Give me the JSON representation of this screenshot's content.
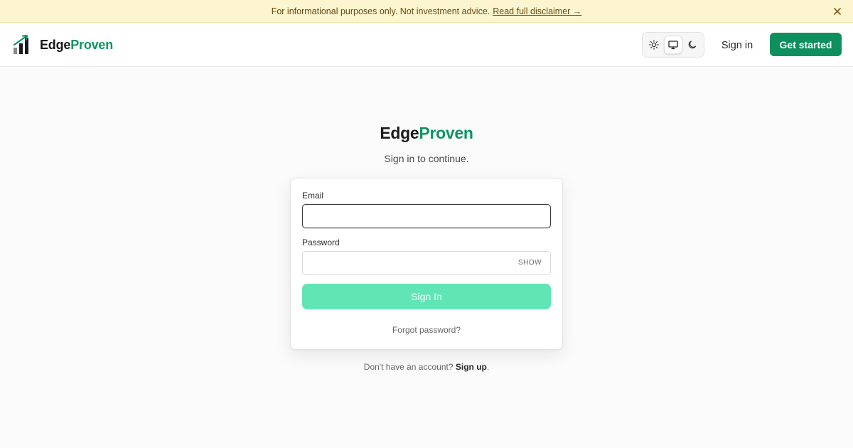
{
  "banner": {
    "text": "For informational purposes only. Not investment advice.",
    "link": "Read full disclaimer →",
    "close_icon": "close-icon"
  },
  "header": {
    "brand_part1": "Edge",
    "brand_part2": "Proven",
    "theme_options": [
      "sun-icon",
      "monitor-icon",
      "moon-icon"
    ],
    "theme_selected": "monitor-icon",
    "signin_label": "Sign in",
    "getstarted_label": "Get started"
  },
  "main": {
    "brand_part1": "Edge",
    "brand_part2": "Proven",
    "subtitle": "Sign in to continue.",
    "form": {
      "email_label": "Email",
      "email_value": "",
      "password_label": "Password",
      "password_value": "",
      "show_label": "SHOW",
      "submit_label": "Sign In",
      "forgot_label": "Forgot password?"
    },
    "signup_prefix": "Don't have an account?",
    "signup_link": "Sign up",
    "signup_suffix": "."
  },
  "colors": {
    "brand_green": "#0e9463",
    "button_green": "#0e8f5e",
    "submit_disabled": "#5fe6b4",
    "banner_bg": "#fdf5cf"
  }
}
